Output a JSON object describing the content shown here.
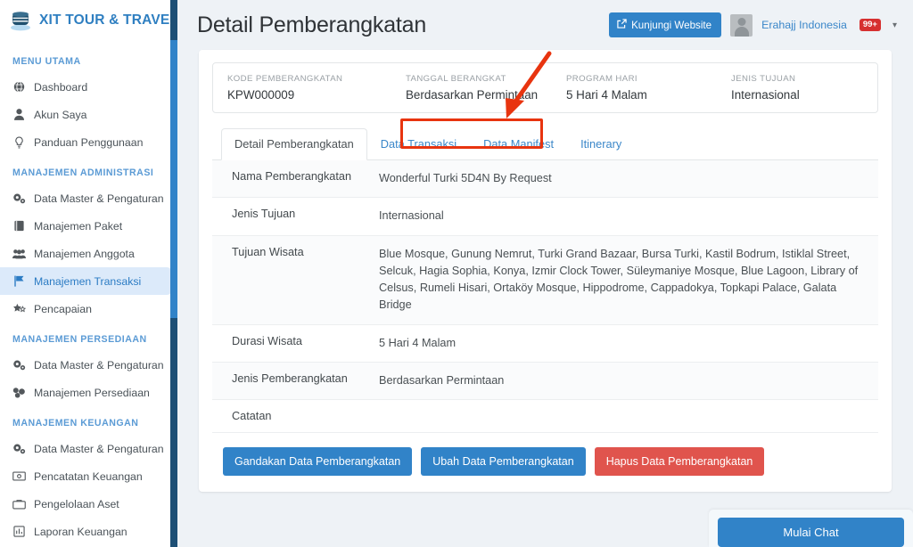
{
  "brand": {
    "name": "XIT TOUR & TRAVEL",
    "logo_icon": "database-stack-icon",
    "color": "#2f7fc1"
  },
  "sidebar": {
    "groups": [
      {
        "heading": "MENU UTAMA",
        "items": [
          {
            "label": "Dashboard",
            "icon": "globe-icon",
            "active": false
          },
          {
            "label": "Akun Saya",
            "icon": "user-icon",
            "active": false
          },
          {
            "label": "Panduan Penggunaan",
            "icon": "lightbulb-icon",
            "active": false
          }
        ]
      },
      {
        "heading": "MANAJEMEN ADMINISTRASI",
        "items": [
          {
            "label": "Data Master & Pengaturan",
            "icon": "gears-icon",
            "active": false
          },
          {
            "label": "Manajemen Paket",
            "icon": "book-icon",
            "active": false
          },
          {
            "label": "Manajemen Anggota",
            "icon": "users-icon",
            "active": false
          },
          {
            "label": "Manajemen Transaksi",
            "icon": "flag-icon",
            "active": true
          },
          {
            "label": "Pencapaian",
            "icon": "star-badge-icon",
            "active": false
          }
        ]
      },
      {
        "heading": "MANAJEMEN PERSEDIAAN",
        "items": [
          {
            "label": "Data Master & Pengaturan",
            "icon": "gears-icon",
            "active": false
          },
          {
            "label": "Manajemen Persediaan",
            "icon": "boxes-icon",
            "active": false
          }
        ]
      },
      {
        "heading": "MANAJEMEN KEUANGAN",
        "items": [
          {
            "label": "Data Master & Pengaturan",
            "icon": "gears-icon",
            "active": false
          },
          {
            "label": "Pencatatan Keuangan",
            "icon": "money-bill-icon",
            "active": false
          },
          {
            "label": "Pengelolaan Aset",
            "icon": "briefcase-icon",
            "active": false
          },
          {
            "label": "Laporan Keuangan",
            "icon": "report-icon",
            "active": false
          }
        ]
      }
    ],
    "scrollbar": {
      "track_color": "#1d4f75",
      "thumb_color": "#3183c8"
    }
  },
  "header": {
    "title": "Detail Pemberangkatan",
    "visit_button": {
      "label": "Kunjungi Website",
      "icon": "external-link-icon",
      "color": "#3183c8"
    },
    "user": {
      "name": "Erahajj Indonesia",
      "badge": "99+",
      "badge_color": "#d63030",
      "avatar_icon": "avatar-placeholder-icon"
    }
  },
  "summary": {
    "fields": [
      {
        "label": "KODE PEMBERANGKATAN",
        "value": "KPW000009"
      },
      {
        "label": "TANGGAL BERANGKAT",
        "value": "Berdasarkan Permintaan"
      },
      {
        "label": "PROGRAM HARI",
        "value": "5 Hari 4 Malam"
      },
      {
        "label": "JENIS TUJUAN",
        "value": "Internasional"
      }
    ]
  },
  "tabs": [
    {
      "label": "Detail Pemberangkatan",
      "active": true
    },
    {
      "label": "Data Transaksi",
      "active": false
    },
    {
      "label": "Data Manifest",
      "active": false
    },
    {
      "label": "Itinerary",
      "active": false
    }
  ],
  "detail_rows": [
    {
      "key": "Nama Pemberangkatan",
      "value": "Wonderful Turki 5D4N By Request"
    },
    {
      "key": "Jenis Tujuan",
      "value": "Internasional"
    },
    {
      "key": "Tujuan Wisata",
      "value": "Blue Mosque, Gunung Nemrut, Turki Grand Bazaar, Bursa Turki, Kastil Bodrum, Istiklal Street, Selcuk, Hagia Sophia, Konya, Izmir Clock Tower, Süleymaniye Mosque, Blue Lagoon, Library of Celsus, Rumeli Hisari, Ortaköy Mosque, Hippodrome, Cappadokya, Topkapi Palace, Galata Bridge"
    },
    {
      "key": "Durasi Wisata",
      "value": "5 Hari 4 Malam"
    },
    {
      "key": "Jenis Pemberangkatan",
      "value": "Berdasarkan Permintaan"
    },
    {
      "key": "Catatan",
      "value": ""
    }
  ],
  "actions": [
    {
      "label": "Gandakan Data Pemberangkatan",
      "style": "blue"
    },
    {
      "label": "Ubah Data Pemberangkatan",
      "style": "blue"
    },
    {
      "label": "Hapus Data Pemberangkatan",
      "style": "red"
    }
  ],
  "chat": {
    "button_label": "Mulai Chat",
    "color": "#3183c8"
  },
  "annotation": {
    "color": "#e8340f",
    "target": "Detail Pemberangkatan tab"
  }
}
